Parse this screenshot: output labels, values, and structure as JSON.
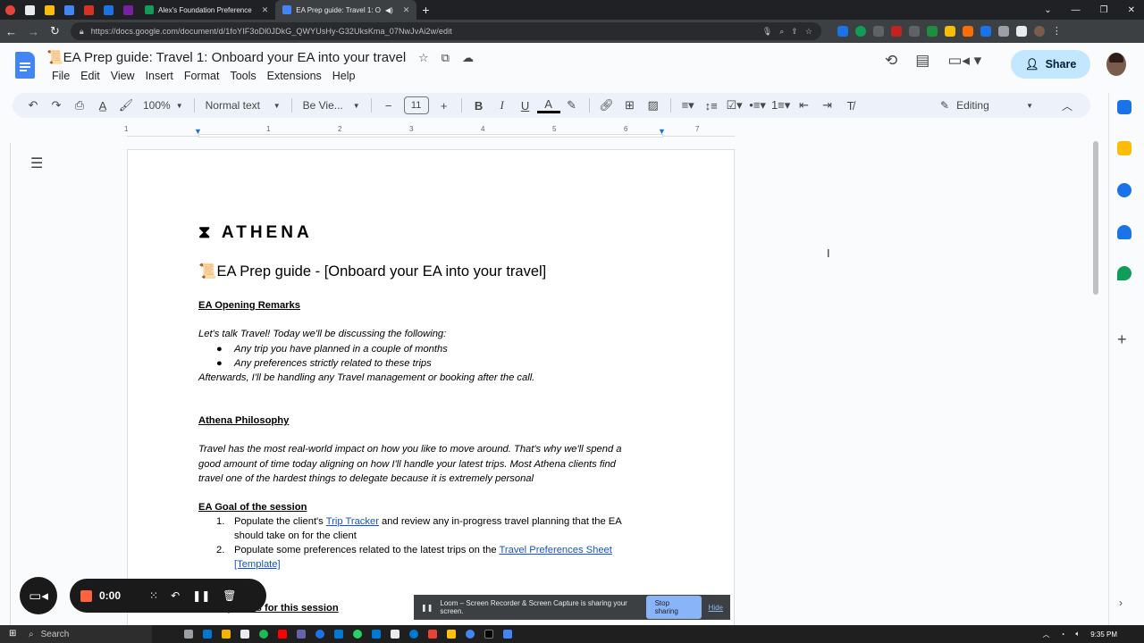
{
  "browser": {
    "tabs": [
      {
        "label": "Alex's Foundation Preference",
        "color": "#0f9d58"
      },
      {
        "label": "EA Prep guide: Travel 1: O",
        "color": "#4285f4",
        "active": true
      }
    ],
    "pinned_tab_colors": [
      "#ea4335",
      "#e8eaed",
      "#fbbc04",
      "#4285f4",
      "#d93025",
      "#1a73e8",
      "#7b1fa2"
    ],
    "url": "https://docs.google.com/document/d/1foYIF3oDl0JDkG_QWYUsHy-G32UksKma_07NwJvAi2w/edit",
    "extension_colors": [
      "#1a73e8",
      "#0f9d58",
      "#5f6368",
      "#c5221f",
      "#5f6368",
      "#1e8e3e",
      "#fbbc04",
      "#ff6d00",
      "#1a73e8",
      "#9aa0a6",
      "#e8eaed"
    ]
  },
  "docs": {
    "title": "📜EA Prep guide: Travel 1: Onboard your EA into your travel",
    "menus": [
      "File",
      "Edit",
      "View",
      "Insert",
      "Format",
      "Tools",
      "Extensions",
      "Help"
    ],
    "share_label": "Share",
    "toolbar": {
      "zoom": "100%",
      "style": "Normal text",
      "font": "Be Vie...",
      "font_size": "11",
      "mode": "Editing"
    },
    "ruler_ticks": [
      "1",
      "1",
      "2",
      "3",
      "4",
      "5",
      "6",
      "7"
    ]
  },
  "document": {
    "logo": "⧗ ATHENA",
    "heading": "📜EA Prep guide - [Onboard your EA into your travel]",
    "section1_title": "EA Opening Remarks",
    "intro": "Let's talk Travel! Today we'll be discussing the following:",
    "bullets": [
      "Any trip you have planned in a couple of months",
      "Any preferences strictly related to these trips"
    ],
    "after": "Afterwards, I'll be handling any Travel management or booking after the call.",
    "section2_title": "Athena Philosophy",
    "philosophy": [
      "Travel has the most real-world impact on how you like to move around. That's why we'll spend a",
      "good amount of time today aligning on how I'll handle your latest trips. Most Athena clients find",
      "travel one of the hardest things to delegate because it is extremely personal"
    ],
    "section3_title": "EA Goal of the session",
    "goal1_pre": "Populate the client's ",
    "goal1_link": "Trip Tracker",
    "goal1_post": " and review any in-progress travel planning that the EA",
    "goal1_cont": "should take on for the client",
    "goal2_pre": "Populate some preferences related to the latest trips on the ",
    "goal2_link": "Travel Preferences Sheet",
    "goal2_cont_link": "[Template]",
    "section4_title": "Prerequisites for this session"
  },
  "loom": {
    "timer": "0:00",
    "banner_text": "Loom – Screen Recorder & Screen Capture is sharing your screen.",
    "stop_label": "Stop sharing",
    "hide_label": "Hide"
  },
  "taskbar": {
    "search_placeholder": "Search",
    "time": "9:35 PM",
    "app_colors": [
      "#9aa0a6",
      "#0078d4",
      "#f4b400",
      "#e8eaed",
      "#1db954",
      "#ff0000",
      "#6264a7",
      "#1a73e8",
      "#0078d4",
      "#25d366",
      "#0078d4",
      "#e8eaed",
      "#0078d4",
      "#ea4335",
      "#ffc107",
      "#4285f4",
      "#000000",
      "#4285f4"
    ]
  },
  "side_panel_colors": [
    "#1a73e8",
    "#fbbc04",
    "#1a73e8",
    "#1a73e8",
    "#0f9d58"
  ]
}
